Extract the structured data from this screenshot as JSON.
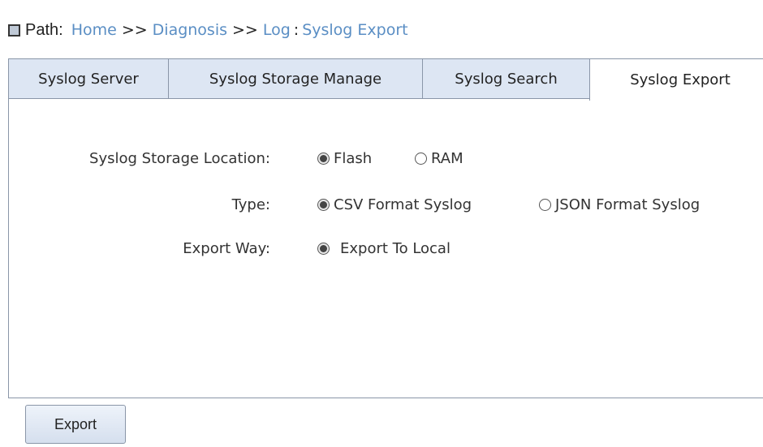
{
  "breadcrumb": {
    "prefix": "Path:",
    "items": [
      "Home",
      "Diagnosis",
      "Log",
      "Syslog Export"
    ],
    "separator": ">>",
    "colon": ":"
  },
  "tabs": [
    {
      "label": "Syslog Server",
      "active": false
    },
    {
      "label": "Syslog Storage Manage",
      "active": false
    },
    {
      "label": "Syslog Search",
      "active": false
    },
    {
      "label": "Syslog Export",
      "active": true
    }
  ],
  "form": {
    "storage_location": {
      "label": "Syslog Storage Location:",
      "options": [
        {
          "label": "Flash",
          "checked": true
        },
        {
          "label": "RAM",
          "checked": false
        }
      ]
    },
    "type": {
      "label": "Type:",
      "options": [
        {
          "label": "CSV Format Syslog",
          "checked": true
        },
        {
          "label": "JSON Format Syslog",
          "checked": false
        }
      ]
    },
    "export_way": {
      "label": "Export Way:",
      "options": [
        {
          "label": "Export To Local",
          "checked": true
        }
      ]
    }
  },
  "buttons": {
    "export_label": "Export"
  },
  "colors": {
    "link": "#5a8ec4",
    "tab_inactive_bg": "#dde6f3",
    "border": "#8a96a8"
  }
}
